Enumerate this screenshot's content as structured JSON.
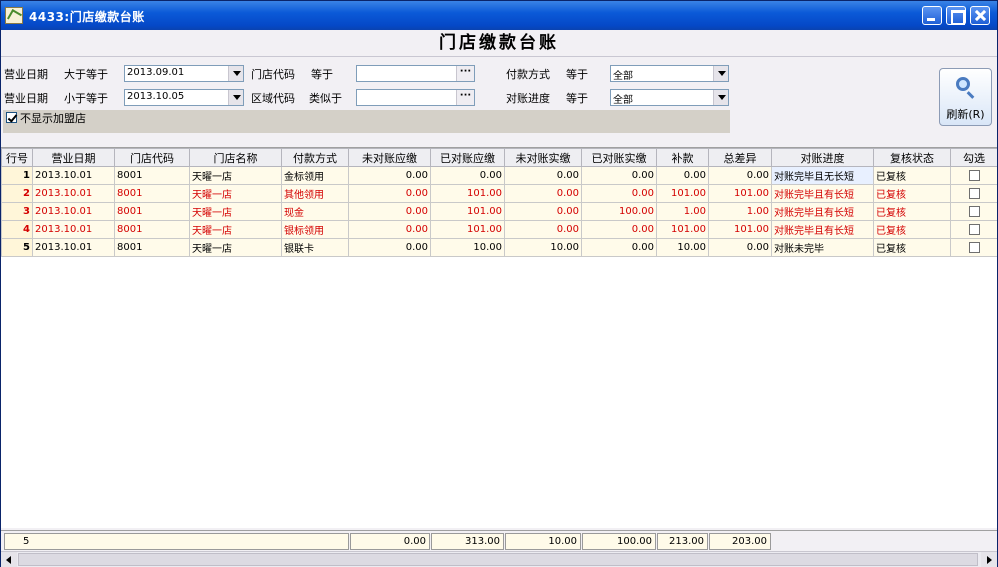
{
  "window": {
    "title": "4433:门店缴款台账"
  },
  "page": {
    "heading": "门店缴款台账"
  },
  "filters": {
    "biz_date_label_1": "营业日期",
    "op_gte": "大于等于",
    "date_from": "2013.09.01",
    "store_code_label": "门店代码",
    "op_eq_1": "等于",
    "store_code_value": "",
    "pay_method_label": "付款方式",
    "op_eq_2": "等于",
    "pay_method_value": "全部",
    "biz_date_label_2": "营业日期",
    "op_lte": "小于等于",
    "date_to": "2013.10.05",
    "region_code_label": "区域代码",
    "op_like": "类似于",
    "region_code_value": "",
    "recon_progress_label": "对账进度",
    "op_eq_3": "等于",
    "recon_progress_value": "全部",
    "hide_franchise_label": "不显示加盟店",
    "ellipsis": "···"
  },
  "toolbar": {
    "refresh_label": "刷新(R)"
  },
  "grid": {
    "columns": [
      "行号",
      "营业日期",
      "门店代码",
      "门店名称",
      "付款方式",
      "未对账应缴",
      "已对账应缴",
      "未对账实缴",
      "已对账实缴",
      "补款",
      "总差异",
      "对账进度",
      "复核状态",
      "勾选"
    ],
    "rows": [
      {
        "no": "1",
        "date": "2013.10.01",
        "code": "8001",
        "name": "天曜一店",
        "method": "金标领用",
        "u_due": "0.00",
        "r_due": "0.00",
        "u_paid": "0.00",
        "r_paid": "0.00",
        "supp": "0.00",
        "diff": "0.00",
        "progress": "对账完毕且无长短",
        "review": "已复核"
      },
      {
        "no": "2",
        "date": "2013.10.01",
        "code": "8001",
        "name": "天曜一店",
        "method": "其他领用",
        "u_due": "0.00",
        "r_due": "101.00",
        "u_paid": "0.00",
        "r_paid": "0.00",
        "supp": "101.00",
        "diff": "101.00",
        "progress": "对账完毕且有长短",
        "review": "已复核"
      },
      {
        "no": "3",
        "date": "2013.10.01",
        "code": "8001",
        "name": "天曜一店",
        "method": "现金",
        "u_due": "0.00",
        "r_due": "101.00",
        "u_paid": "0.00",
        "r_paid": "100.00",
        "supp": "1.00",
        "diff": "1.00",
        "progress": "对账完毕且有长短",
        "review": "已复核"
      },
      {
        "no": "4",
        "date": "2013.10.01",
        "code": "8001",
        "name": "天曜一店",
        "method": "银标领用",
        "u_due": "0.00",
        "r_due": "101.00",
        "u_paid": "0.00",
        "r_paid": "0.00",
        "supp": "101.00",
        "diff": "101.00",
        "progress": "对账完毕且有长短",
        "review": "已复核"
      },
      {
        "no": "5",
        "date": "2013.10.01",
        "code": "8001",
        "name": "天曜一店",
        "method": "银联卡",
        "u_due": "0.00",
        "r_due": "10.00",
        "u_paid": "10.00",
        "r_paid": "0.00",
        "supp": "10.00",
        "diff": "0.00",
        "progress": "对账未完毕",
        "review": "已复核"
      }
    ]
  },
  "footer": {
    "count": "5",
    "u_due": "0.00",
    "r_due": "313.00",
    "u_paid": "10.00",
    "r_paid": "100.00",
    "supp": "213.00",
    "diff": "203.00"
  },
  "colors": {
    "titlebar": "#0b5ad8",
    "red_text": "#d40000",
    "row_bg": "#fffbea"
  }
}
